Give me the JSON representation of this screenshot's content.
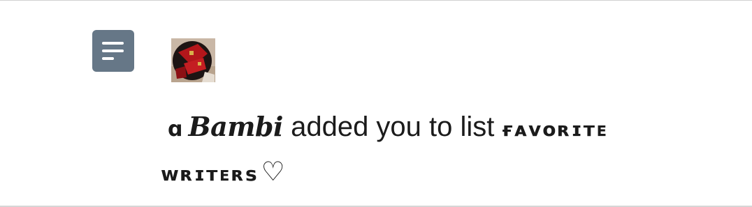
{
  "notification": {
    "prefix_glyph": "ɑ",
    "user_name": "Bambi",
    "action_text": "added you to list",
    "list_name_line1": "ғᴀᴠᴏʀɪᴛᴇ",
    "list_name_line2": "ᴡʀɪᴛᴇʀs",
    "heart": "♡"
  },
  "icons": {
    "list_icon": "list-lines-icon",
    "avatar": "user-avatar-image"
  },
  "colors": {
    "list_icon_bg": "#667787",
    "text": "#1b1b1b",
    "divider": "#d0d0d0"
  }
}
